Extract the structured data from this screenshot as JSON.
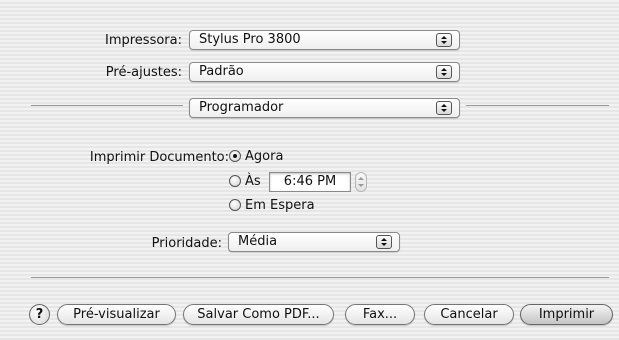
{
  "printer": {
    "label": "Impressora:",
    "value": "Stylus Pro 3800"
  },
  "presets": {
    "label": "Pré-ajustes:",
    "value": "Padrão"
  },
  "panel": {
    "value": "Programador"
  },
  "schedule": {
    "label": "Imprimir Documento:",
    "options": [
      {
        "label": "Agora",
        "selected": true
      },
      {
        "label": "Às",
        "selected": false
      },
      {
        "label": "Em Espera",
        "selected": false
      }
    ],
    "time": "6:46 PM"
  },
  "priority": {
    "label": "Prioridade:",
    "value": "Média"
  },
  "buttons": {
    "help": "?",
    "preview": "Pré-visualizar",
    "save_pdf": "Salvar Como PDF...",
    "fax": "Fax...",
    "cancel": "Cancelar",
    "print": "Imprimir"
  }
}
